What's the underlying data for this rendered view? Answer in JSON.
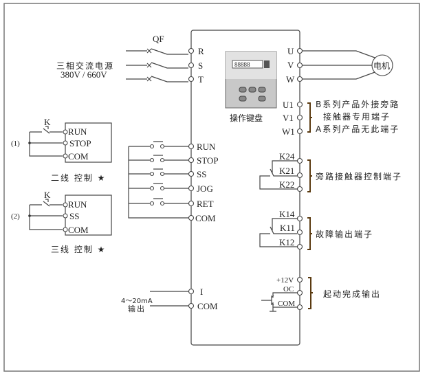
{
  "power": {
    "breaker": "QF",
    "source_label": "三相交流电源",
    "voltage": "380V / 660V",
    "terminals": [
      "R",
      "S",
      "T"
    ]
  },
  "keypad": {
    "label": "操作键盘",
    "display": "88888"
  },
  "motor": {
    "label": "电机",
    "terminals": [
      "U",
      "V",
      "W"
    ]
  },
  "bypass_terminals": {
    "terminals": [
      "U1",
      "V1",
      "W1"
    ],
    "notes": [
      "B系列产品外接旁路",
      "接触器专用端子",
      "A系列产品无此端子"
    ]
  },
  "control_inputs": {
    "terminals": [
      "RUN",
      "STOP",
      "SS",
      "JOG",
      "RET",
      "COM"
    ]
  },
  "bypass_relay": {
    "terminals": [
      "K24",
      "K21",
      "K22"
    ],
    "label": "旁路接触器控制端子"
  },
  "fault_relay": {
    "terminals": [
      "K14",
      "K11",
      "K12"
    ],
    "label": "故障输出端子"
  },
  "analog_output": {
    "terminals": [
      "I",
      "COM"
    ],
    "label_line1": "4～20mA",
    "label_line2": "输出"
  },
  "start_output": {
    "terminals": [
      "+12V",
      "OC",
      "COM"
    ],
    "label": "起动完成输出"
  },
  "two_wire": {
    "marker": "(1)",
    "switch": "K",
    "terminals": [
      "RUN",
      "STOP",
      "COM"
    ],
    "caption": "二线 控制 ★"
  },
  "three_wire": {
    "marker": "(2)",
    "switch": "K",
    "terminals": [
      "RUN",
      "SS",
      "COM"
    ],
    "caption": "三线 控制 ★"
  },
  "colors": {
    "wire": "#444444",
    "bracket": "#5a3a10"
  }
}
